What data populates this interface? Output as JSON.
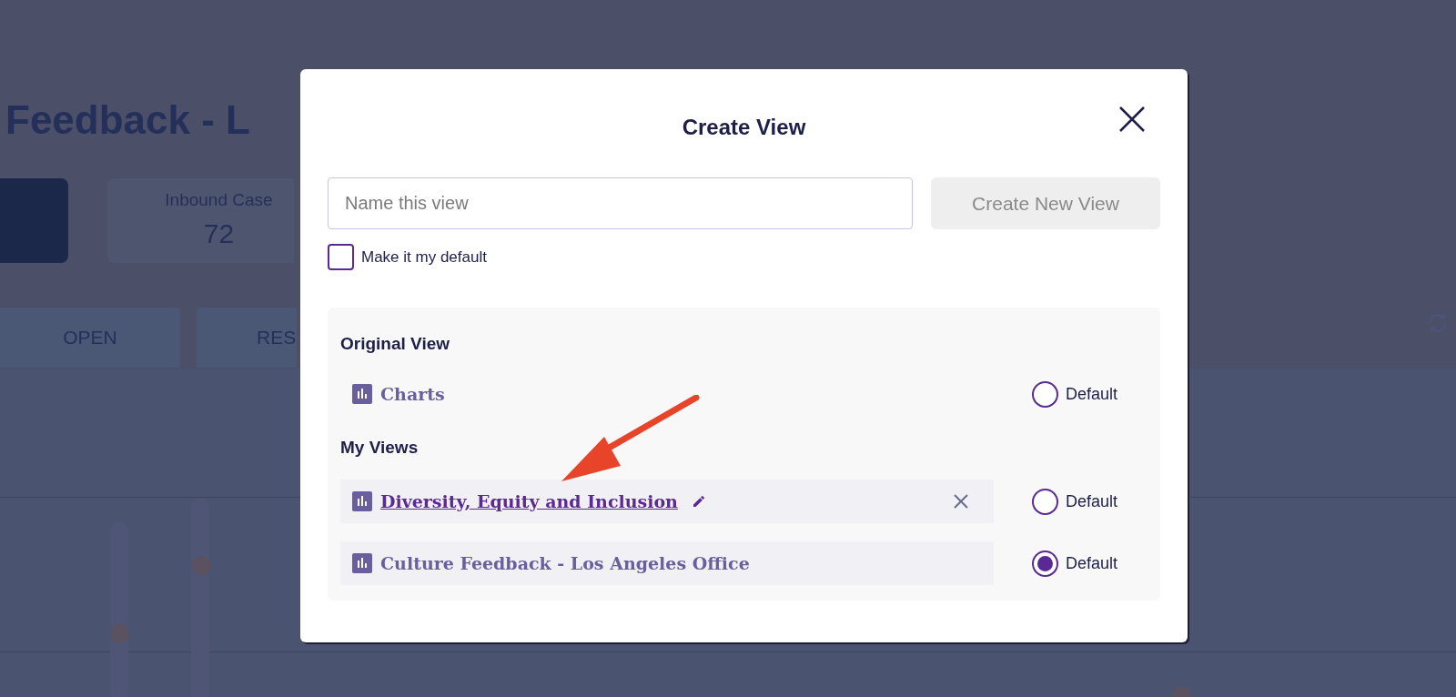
{
  "background": {
    "title": "Feedback - L",
    "stat_card": {
      "label": "Inbound Case",
      "value": "72"
    },
    "tabs": [
      {
        "label": "OPEN"
      },
      {
        "label": "RES"
      }
    ]
  },
  "dialog": {
    "title": "Create View",
    "name_field": {
      "placeholder": "Name this view"
    },
    "create_button": {
      "label": "Create New View",
      "disabled": true
    },
    "default_checkbox": {
      "label": "Make it my default",
      "checked": false
    },
    "sections": [
      {
        "heading": "Original View",
        "views": [
          {
            "kind": "original",
            "name": "Charts",
            "hovered": false,
            "radio_label": "Default",
            "selected": false
          }
        ]
      },
      {
        "heading": "My Views",
        "views": [
          {
            "kind": "custom",
            "name": "Diversity, Equity and Inclusion",
            "hovered": true,
            "radio_label": "Default",
            "selected": false
          },
          {
            "kind": "custom",
            "name": "Culture Feedback - Los Angeles Office",
            "hovered": false,
            "radio_label": "Default",
            "selected": true
          }
        ]
      }
    ]
  }
}
